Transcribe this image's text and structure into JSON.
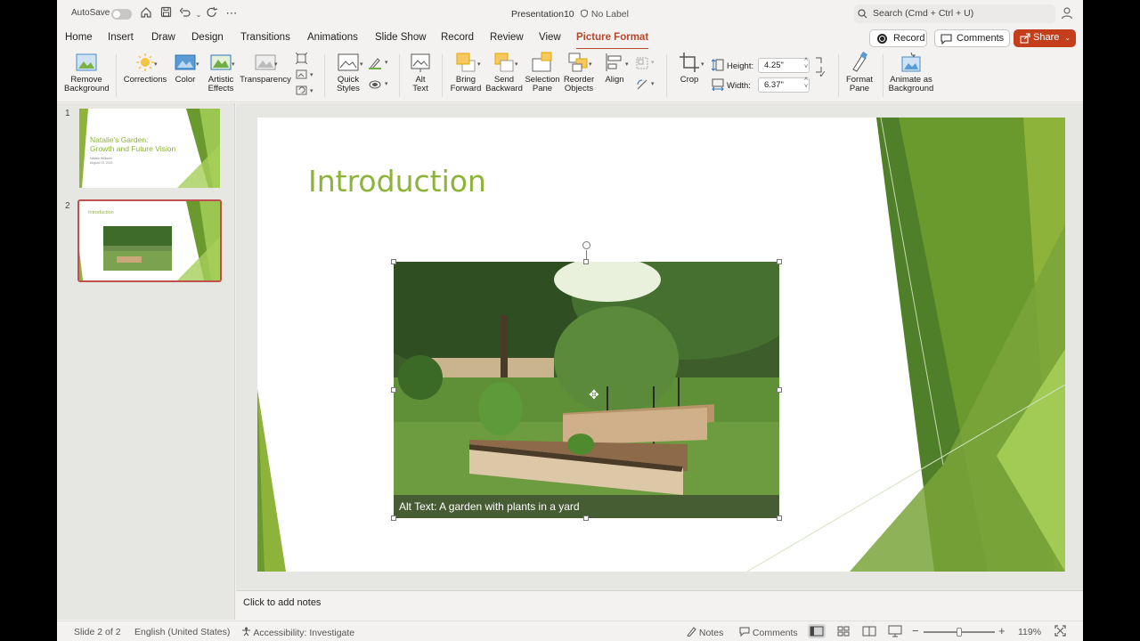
{
  "titlebar": {
    "autosave_label": "AutoSave",
    "doc_title": "Presentation10",
    "label": "No Label",
    "search_placeholder": "Search (Cmd + Ctrl + U)"
  },
  "tabs": [
    {
      "label": "Home"
    },
    {
      "label": "Insert"
    },
    {
      "label": "Draw"
    },
    {
      "label": "Design"
    },
    {
      "label": "Transitions"
    },
    {
      "label": "Animations"
    },
    {
      "label": "Slide Show"
    },
    {
      "label": "Record"
    },
    {
      "label": "Review"
    },
    {
      "label": "View"
    },
    {
      "label": "Picture Format",
      "active": true
    }
  ],
  "actions": {
    "record": "Record",
    "comments": "Comments",
    "share": "Share"
  },
  "ribbon": {
    "remove_background": "Remove Background",
    "corrections": "Corrections",
    "color": "Color",
    "artistic_effects": "Artistic Effects",
    "transparency": "Transparency",
    "quick_styles": "Quick Styles",
    "alt_text": "Alt Text",
    "bring_forward": "Bring Forward",
    "send_backward": "Send Backward",
    "selection_pane": "Selection Pane",
    "reorder_objects": "Reorder Objects",
    "align": "Align",
    "crop": "Crop",
    "height_label": "Height:",
    "height_value": "4.25\"",
    "width_label": "Width:",
    "width_value": "6.37\"",
    "format_pane": "Format Pane",
    "animate_background": "Animate as Background"
  },
  "thumbnails": [
    {
      "num": "1",
      "title": "Natalie's Garden:",
      "title2": "Growth and Future Vision",
      "sub1": "Natalie Williams",
      "sub2": "August 15, 2023"
    },
    {
      "num": "2",
      "title": "Introduction"
    }
  ],
  "slide": {
    "title": "Introduction",
    "alt_text_caption": "Alt Text: A garden with plants in a yard"
  },
  "notes_placeholder": "Click to add notes",
  "status": {
    "slide_info": "Slide 2 of 2",
    "language": "English (United States)",
    "accessibility": "Accessibility: Investigate",
    "notes": "Notes",
    "comments": "Comments",
    "zoom": "119%"
  },
  "colors": {
    "accent": "#b7472a",
    "share": "#c43e1c",
    "theme_green": "#8db33a"
  }
}
